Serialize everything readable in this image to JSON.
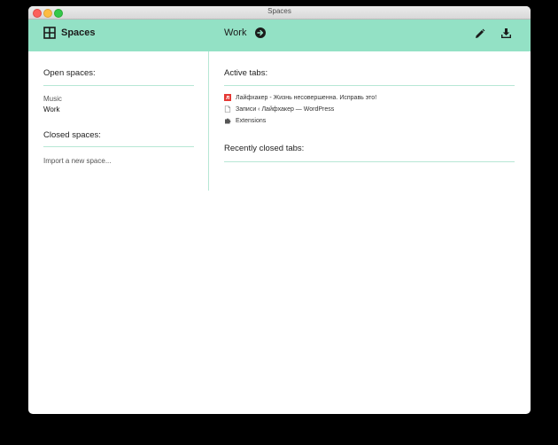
{
  "window": {
    "title": "Spaces"
  },
  "header": {
    "brand_label": "Spaces",
    "current_space": "Work",
    "accent_color": "#93e1c5"
  },
  "left": {
    "open_heading": "Open spaces:",
    "open_spaces": [
      {
        "name": "Music",
        "active": false
      },
      {
        "name": "Work",
        "active": true
      }
    ],
    "closed_heading": "Closed spaces:",
    "import_label": "Import a new space..."
  },
  "right": {
    "active_heading": "Active tabs:",
    "tabs": [
      {
        "title": "Лайфхакер - Жизнь несовершенна. Исправь это!",
        "icon": "lifehacker-favicon-icon"
      },
      {
        "title": "Записи ‹ Лайфхакер — WordPress",
        "icon": "page-icon"
      },
      {
        "title": "Extensions",
        "icon": "puzzle-icon"
      }
    ],
    "recent_heading": "Recently closed tabs:"
  }
}
